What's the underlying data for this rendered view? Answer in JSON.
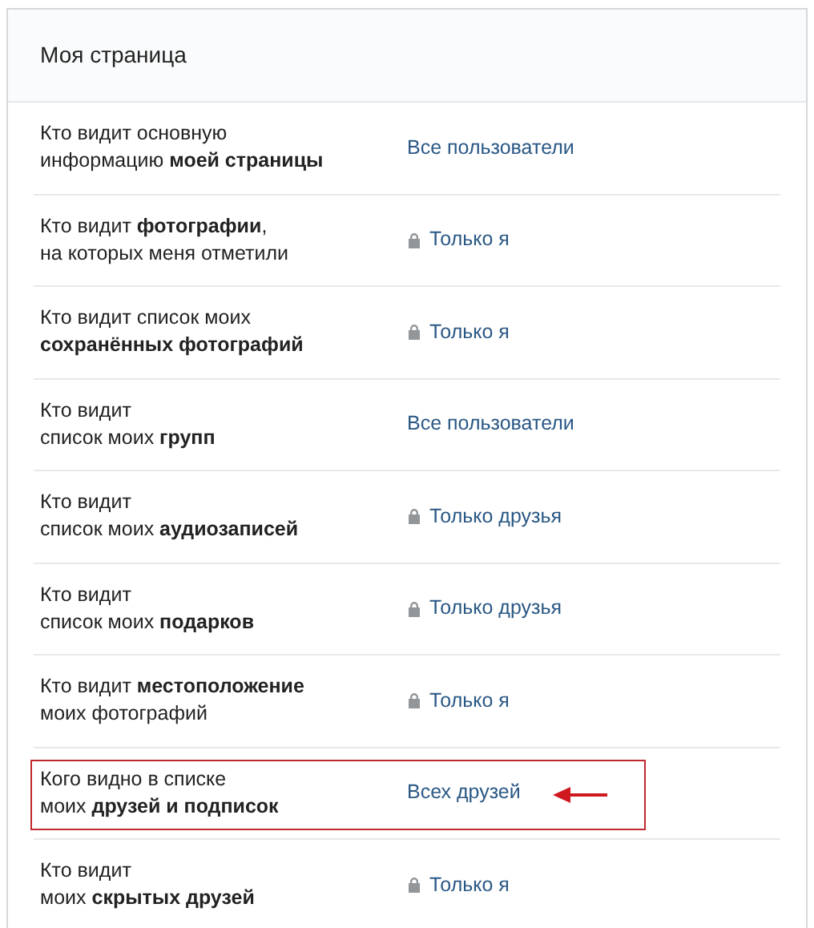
{
  "header": {
    "title": "Моя страница"
  },
  "rows": [
    {
      "lines": [
        "Кто видит основную",
        "информацию **моей страницы**"
      ],
      "value": "Все пользователи",
      "locked": false,
      "highlighted": false
    },
    {
      "lines": [
        "Кто видит **фотографии**,",
        "на которых меня отметили"
      ],
      "value": "Только я",
      "locked": true,
      "highlighted": false
    },
    {
      "lines": [
        "Кто видит список моих",
        "**сохранённых фотографий**"
      ],
      "value": "Только я",
      "locked": true,
      "highlighted": false
    },
    {
      "lines": [
        "Кто видит",
        "список моих **групп**"
      ],
      "value": "Все пользователи",
      "locked": false,
      "highlighted": false
    },
    {
      "lines": [
        "Кто видит",
        "список моих **аудиозаписей**"
      ],
      "value": "Только друзья",
      "locked": true,
      "highlighted": false
    },
    {
      "lines": [
        "Кто видит",
        "список моих **подарков**"
      ],
      "value": "Только друзья",
      "locked": true,
      "highlighted": false
    },
    {
      "lines": [
        "Кто видит **местоположение**",
        "моих фотографий"
      ],
      "value": "Только я",
      "locked": true,
      "highlighted": false
    },
    {
      "lines": [
        "Кого видно в списке",
        "моих **друзей и подписок**"
      ],
      "value": "Всех друзей",
      "locked": false,
      "highlighted": true
    },
    {
      "lines": [
        "Кто видит",
        "моих **скрытых друзей**"
      ],
      "value": "Только я",
      "locked": true,
      "highlighted": false
    }
  ]
}
